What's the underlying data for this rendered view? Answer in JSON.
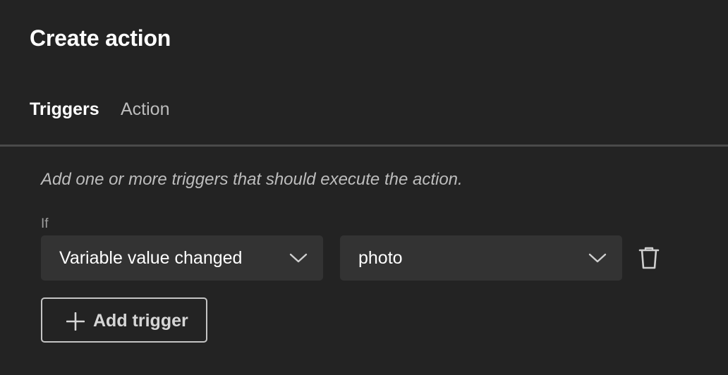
{
  "dialog": {
    "title": "Create action"
  },
  "tabs": [
    {
      "label": "Triggers",
      "active": true
    },
    {
      "label": "Action",
      "active": false
    }
  ],
  "triggers": {
    "hint": "Add one or more triggers that should execute the action.",
    "condition_label": "If",
    "trigger_type": "Variable value changed",
    "variable": "photo",
    "add_label": "Add trigger"
  },
  "icons": {
    "chevron": "chevron-down-icon",
    "delete": "trash-icon",
    "add": "plus-icon"
  },
  "colors": {
    "background": "#232323",
    "field_background": "#333333",
    "text_primary": "#ffffff",
    "text_secondary": "#bdbdbd",
    "divider": "#4a4a4a"
  }
}
